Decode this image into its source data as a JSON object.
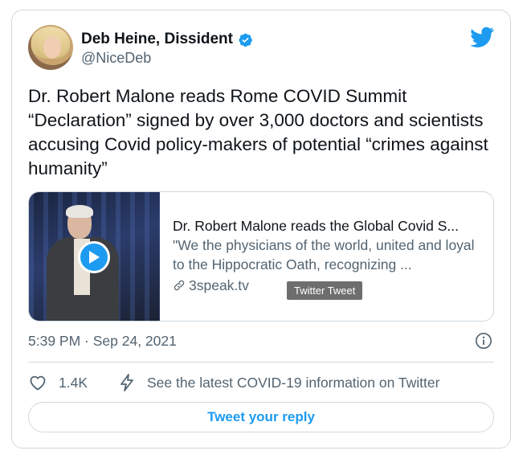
{
  "author": {
    "display_name": "Deb Heine, Dissident",
    "handle": "@NiceDeb"
  },
  "tweet": {
    "text": "Dr. Robert Malone reads Rome COVID Summit “Declaration” signed by over 3,000 doctors and scientists accusing Covid policy-makers of potential “crimes against humanity”",
    "timestamp": "5:39 PM · Sep 24, 2021"
  },
  "link_card": {
    "title": "Dr. Robert Malone reads the Global Covid S...",
    "description": "\"We the physicians of the world, united and loyal to the Hippocratic Oath, recognizing ...",
    "domain": "3speak.tv"
  },
  "tooltip": "Twitter Tweet",
  "actions": {
    "like_count": "1.4K",
    "covid_info": "See the latest COVID-19 information on Twitter",
    "reply_label": "Tweet your reply"
  },
  "colors": {
    "accent": "#1d9bf0",
    "text_primary": "#0f1419",
    "text_secondary": "#536471",
    "border": "#cfd9de"
  },
  "icons": [
    "twitter-bird-icon",
    "verified-badge-icon",
    "play-icon",
    "link-icon",
    "info-icon",
    "heart-icon",
    "lightning-icon"
  ]
}
